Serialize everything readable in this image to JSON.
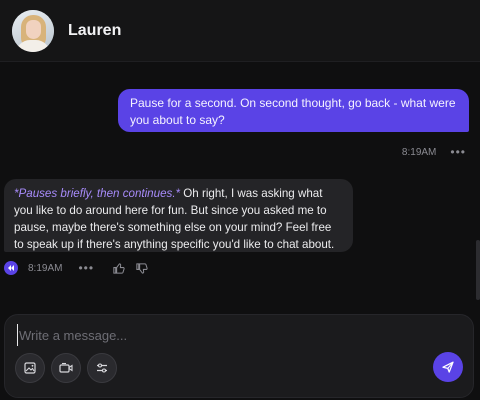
{
  "header": {
    "contact_name": "Lauren",
    "avatar_icon": "profile-photo"
  },
  "messages": [
    {
      "sender": "user",
      "text": "Pause for a second. On second thought, go back - what were you about to say?",
      "time": "8:19AM",
      "menu_icon": "more-dots-icon"
    },
    {
      "sender": "Lauren",
      "action": "*Pauses briefly, then continues.*",
      "text": " Oh right, I was asking what you like to do around here for fun. But since you asked me to pause, maybe there's something else on your mind? Feel free to speak up if there's anything specific you'd like to chat about.",
      "time": "8:19AM",
      "icons": [
        "play-audio-icon",
        "more-dots-icon",
        "thumbs-up-icon",
        "thumbs-down-icon"
      ]
    }
  ],
  "composer": {
    "placeholder": "Write a message...",
    "value": "",
    "tools": [
      "image-icon",
      "video-icon",
      "settings-sliders-icon"
    ],
    "send_icon": "send-icon"
  },
  "colors": {
    "accent": "#5a43e6",
    "action_text": "#a78bfa",
    "background": "#0f0f10",
    "ai_bubble": "#242427"
  },
  "labels": {
    "more": "•••"
  }
}
